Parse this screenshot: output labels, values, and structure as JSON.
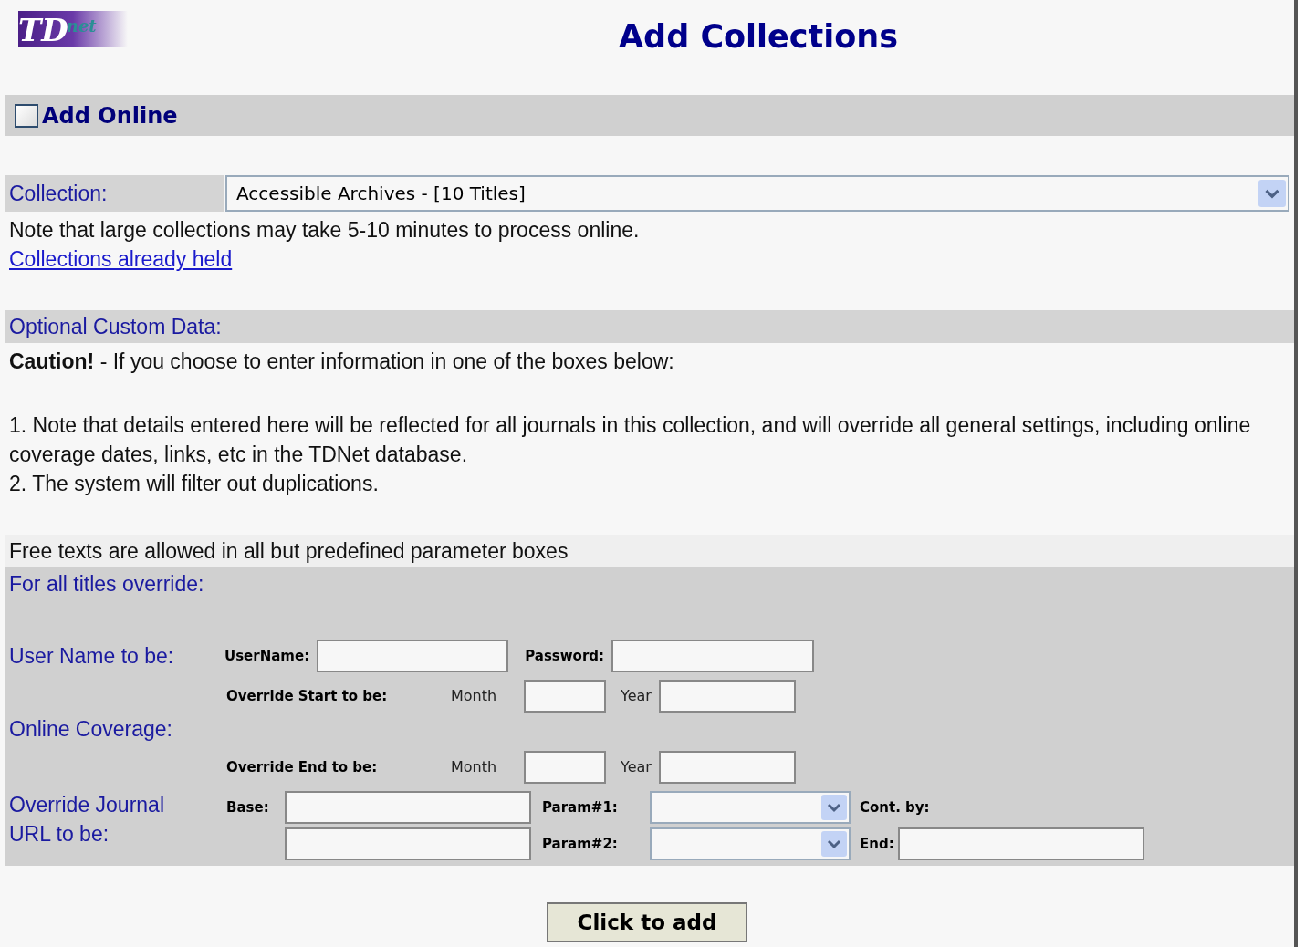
{
  "logo": {
    "main": "TD",
    "script": "net"
  },
  "title": "Add Collections",
  "add_online": {
    "label": "Add Online",
    "checked": false
  },
  "collection": {
    "label": "Collection:",
    "value": "Accessible Archives - [10 Titles]"
  },
  "note": "Note that large collections may take 5-10 minutes to process online.",
  "link": "Collections already held",
  "custom": {
    "heading": "Optional Custom Data:",
    "caution": "**Caution!** - If you choose to enter information in one of the boxes below:",
    "points": [
      "1. Note that details entered here will be reflected for all journals in this collection, and will override all general settings, including online coverage dates, links, etc in the TDNet database.",
      "2. The system will filter out duplications."
    ]
  },
  "free_text_note": "Free texts are allowed in all but predefined parameter boxes",
  "override": {
    "heading": "For all titles override:",
    "user": {
      "label": "User Name to be:",
      "username_label": "UserName:",
      "password_label": "Password:"
    },
    "coverage": {
      "label": "Online Coverage:",
      "start": {
        "label": "Override Start to be:",
        "month": "Month",
        "year": "Year"
      },
      "end": {
        "label": "Override End to be:",
        "month": "Month",
        "year": "Year"
      }
    },
    "url": {
      "label": "Override Journal URL to be:",
      "base_label": "Base:",
      "param1_label": "Param#1:",
      "cont_label": "Cont. by:",
      "param2_label": "Param#2:",
      "end_label": "End:"
    }
  },
  "button": "Click to add"
}
